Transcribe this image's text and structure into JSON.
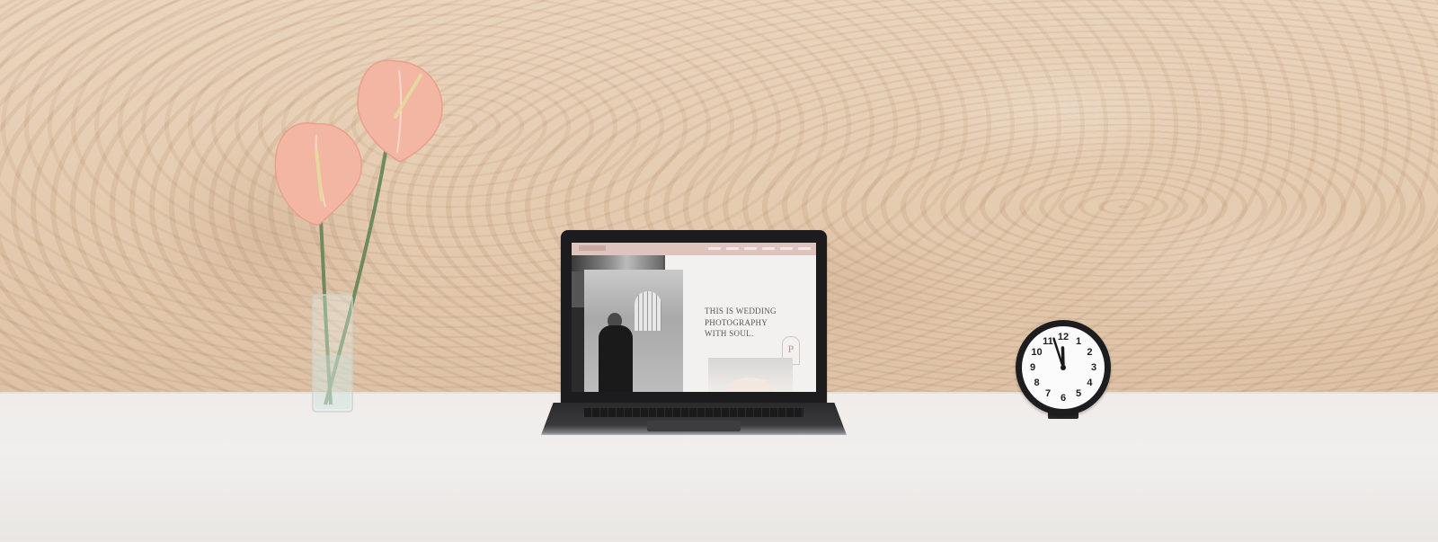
{
  "scene": {
    "colors": {
      "wall": "#e2c6a8",
      "desk": "#efecea",
      "flower": "#f2b6a2",
      "laptop_bezel": "#1c1c1e",
      "site_nav": "#dfc4be",
      "clock_rim": "#1d1d1f"
    }
  },
  "laptop_screen": {
    "headline_line1": "THIS IS WEDDING",
    "headline_line2": "PHOTOGRAPHY",
    "headline_line3": "WITH SOUL.",
    "monogram": "P"
  },
  "clock": {
    "numbers": [
      "12",
      "1",
      "2",
      "3",
      "4",
      "5",
      "6",
      "7",
      "8",
      "9",
      "10",
      "11"
    ],
    "time": "11:57"
  }
}
